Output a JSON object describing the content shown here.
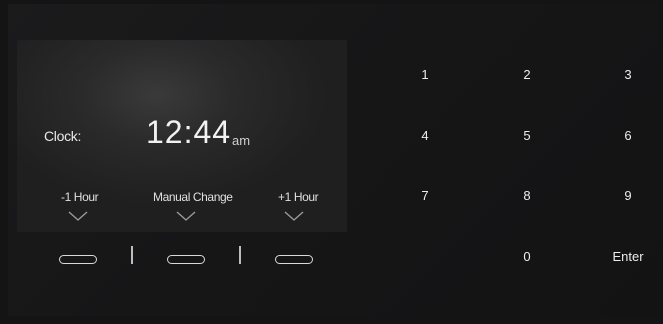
{
  "display": {
    "clock_label": "Clock:",
    "time": "12:44",
    "ampm": "am"
  },
  "soft_keys": {
    "minus_hour": "-1 Hour",
    "manual_change": "Manual Change",
    "plus_hour": "+1 Hour"
  },
  "keypad": {
    "k1": "1",
    "k2": "2",
    "k3": "3",
    "k4": "4",
    "k5": "5",
    "k6": "6",
    "k7": "7",
    "k8": "8",
    "k9": "9",
    "k0": "0",
    "enter": "Enter"
  },
  "icons": {
    "chevron": "chevron-down-icon",
    "pill_button": "pill-button-icon"
  },
  "colors": {
    "background": "#141414",
    "screen": "#2a2a2b",
    "text": "#e6e6e6"
  }
}
